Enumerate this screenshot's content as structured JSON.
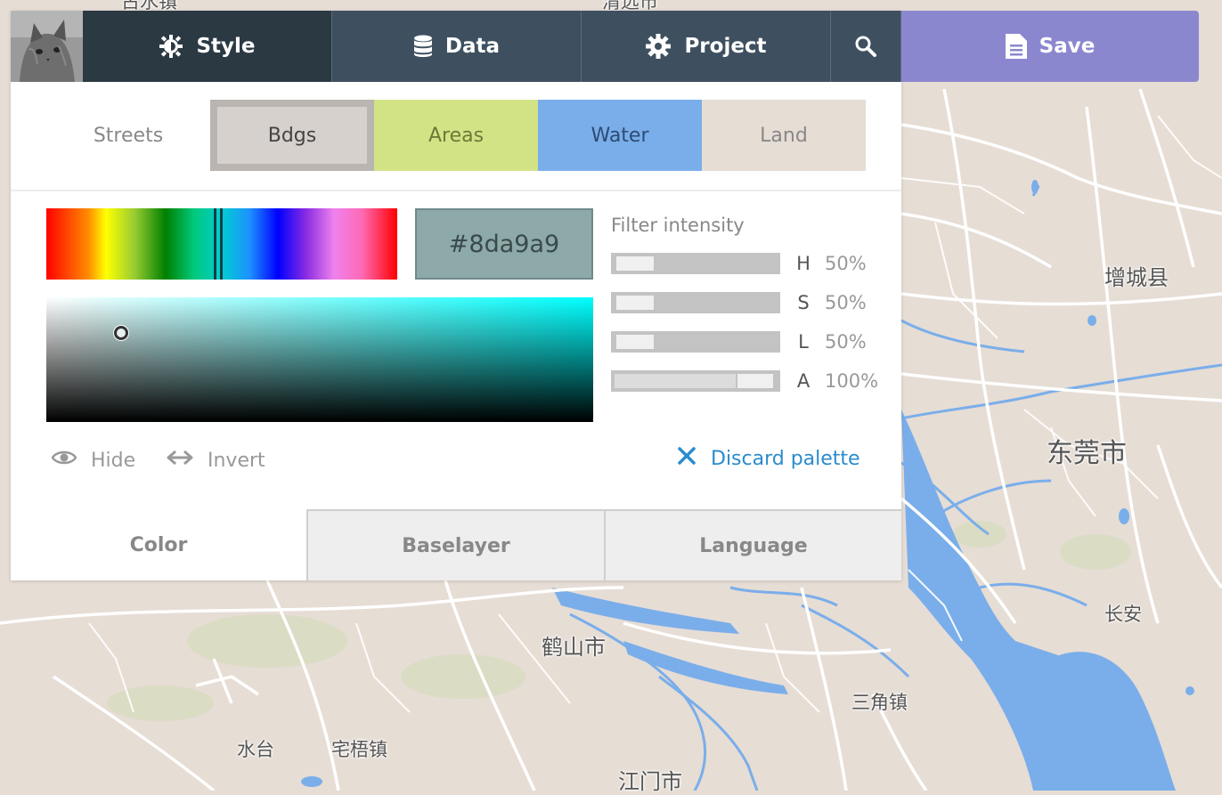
{
  "topbar": {
    "style_label": "Style",
    "data_label": "Data",
    "project_label": "Project",
    "save_label": "Save"
  },
  "layer_tabs": [
    {
      "label": "Streets",
      "bg": "#ffffff",
      "color": "#888888"
    },
    {
      "label": "Bdgs",
      "bg": "#d6d1cc",
      "color": "#444444",
      "active": true
    },
    {
      "label": "Areas",
      "bg": "#d2e386",
      "color": "#6c7a38"
    },
    {
      "label": "Water",
      "bg": "#7aaeea",
      "color": "#2c4c74"
    },
    {
      "label": "Land",
      "bg": "#e6ddd5",
      "color": "#888888"
    }
  ],
  "color": {
    "hex": "#8da9a9",
    "hue_fraction": 0.5
  },
  "filter": {
    "title": "Filter intensity",
    "rows": [
      {
        "letter": "H",
        "value": "50%"
      },
      {
        "letter": "S",
        "value": "50%"
      },
      {
        "letter": "L",
        "value": "50%"
      },
      {
        "letter": "A",
        "value": "100%"
      }
    ]
  },
  "actions": {
    "hide_label": "Hide",
    "invert_label": "Invert",
    "discard_label": "Discard palette"
  },
  "bottom_tabs": [
    "Color",
    "Baselayer",
    "Language"
  ],
  "map": {
    "labels": [
      "古水镇",
      "清远市",
      "增城县",
      "东莞市",
      "长安",
      "鹤山市",
      "三角镇",
      "水台",
      "宅梧镇",
      "江门市"
    ]
  },
  "colors": {
    "accent": "#2a8ccc",
    "save": "#8b87cf",
    "nav": "#3e5060",
    "nav_active": "#2b3943",
    "water": "#7aaeea",
    "land": "#e6ddd5"
  }
}
